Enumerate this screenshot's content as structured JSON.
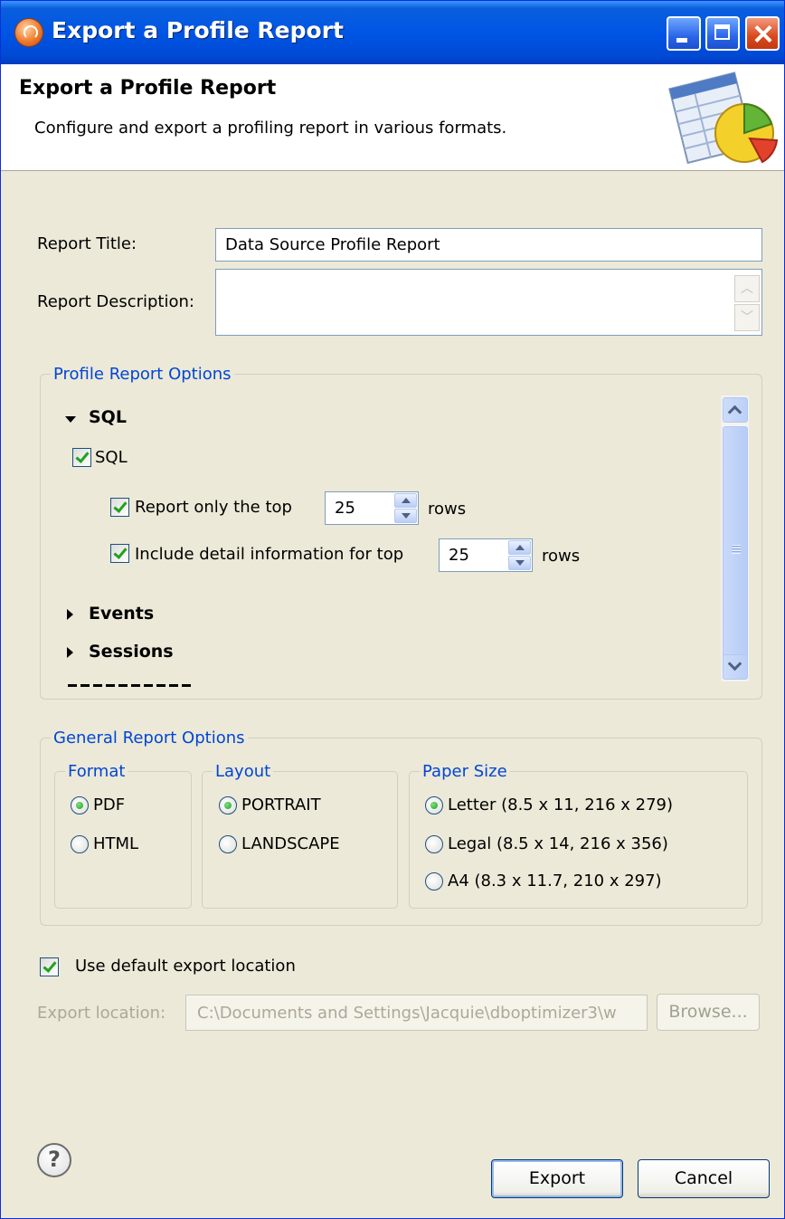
{
  "window": {
    "title": "Export a Profile Report"
  },
  "header": {
    "title": "Export a Profile Report",
    "description": "Configure and export a profiling report in various formats."
  },
  "form": {
    "report_title_label": "Report Title:",
    "report_title_value": "Data Source Profile Report",
    "report_description_label": "Report Description:",
    "report_description_value": ""
  },
  "profile_options": {
    "group_title": "Profile Report Options",
    "sql_section": "SQL",
    "sql_checkbox": {
      "label": "SQL",
      "checked": true
    },
    "top_rows": {
      "label": "Report only the top",
      "checked": true,
      "value": "25",
      "suffix": "rows"
    },
    "detail_rows": {
      "label": "Include detail information for top",
      "checked": true,
      "value": "25",
      "suffix": "rows"
    },
    "events_section": "Events",
    "sessions_section": "Sessions"
  },
  "general_options": {
    "group_title": "General Report Options",
    "format": {
      "title": "Format",
      "options": [
        "PDF",
        "HTML"
      ],
      "selected": "PDF"
    },
    "layout": {
      "title": "Layout",
      "options": [
        "PORTRAIT",
        "LANDSCAPE"
      ],
      "selected": "PORTRAIT"
    },
    "paper_size": {
      "title": "Paper Size",
      "options": [
        "Letter (8.5 x 11, 216 x 279)",
        "Legal (8.5 x 14, 216 x 356)",
        "A4 (8.3 x 11.7, 210 x 297)"
      ],
      "selected": "Letter (8.5 x 11, 216 x 279)"
    }
  },
  "export": {
    "use_default_label": "Use default export location",
    "use_default_checked": true,
    "location_label": "Export location:",
    "location_value": "C:\\Documents and Settings\\Jacquie\\dboptimizer3\\w",
    "browse_label": "Browse..."
  },
  "footer": {
    "help_symbol": "?",
    "export_label": "Export",
    "cancel_label": "Cancel"
  },
  "colors": {
    "titlebar": "#0055e5",
    "group_title": "#0046d5",
    "check_green": "#21a121",
    "dialog_bg": "#ece9d8"
  }
}
